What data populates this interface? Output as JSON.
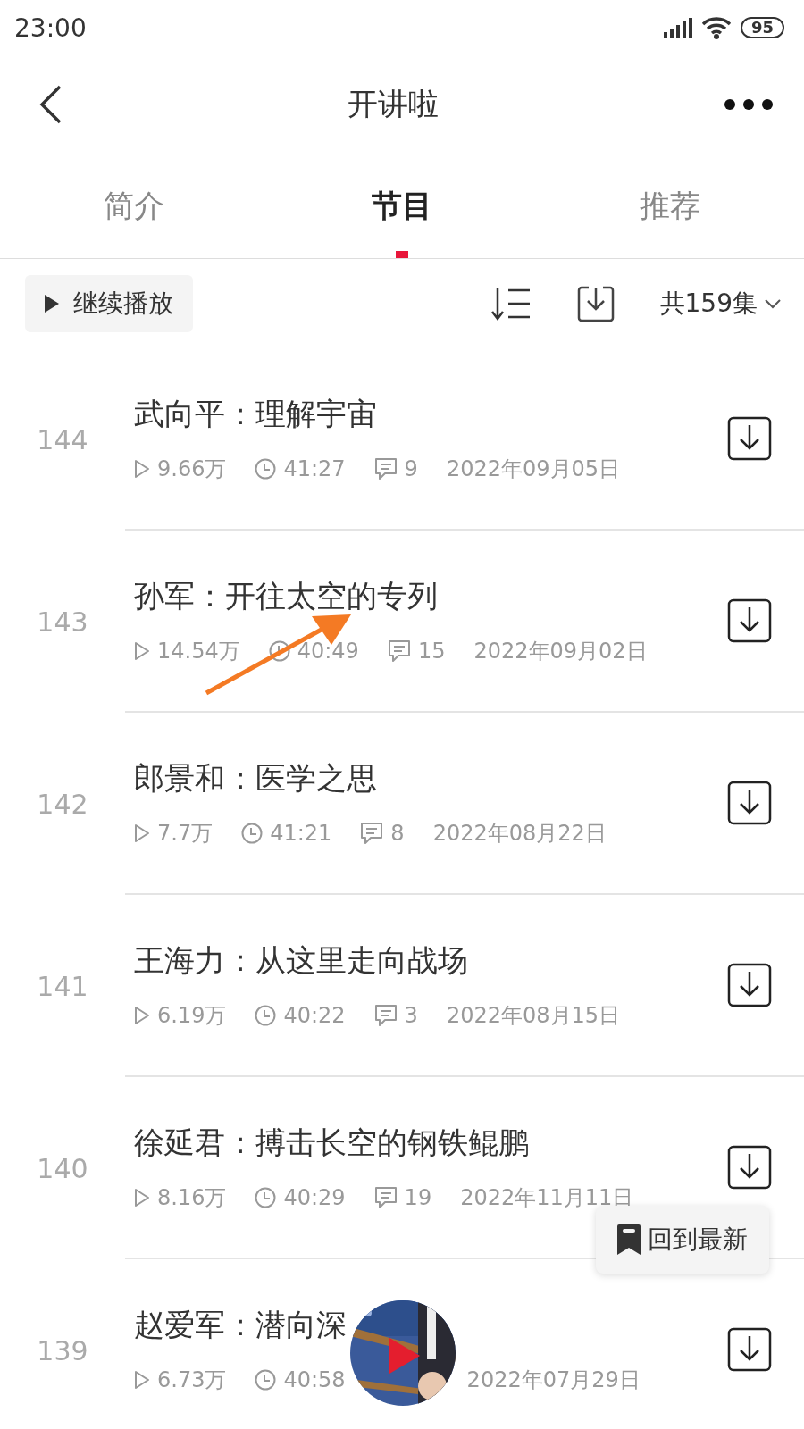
{
  "status_bar": {
    "time": "23:00",
    "battery": "95"
  },
  "nav": {
    "title": "开讲啦"
  },
  "tabs": [
    {
      "label": "简介",
      "selected": false
    },
    {
      "label": "节目",
      "selected": true
    },
    {
      "label": "推荐",
      "selected": false
    }
  ],
  "toolbar": {
    "continue_button": "继续播放",
    "count": "共159集"
  },
  "episodes": [
    {
      "number": "144",
      "title": "武向平：理解宇宙",
      "plays": "9.66万",
      "duration": "41:27",
      "comments": "9",
      "date": "2022年09月05日"
    },
    {
      "number": "143",
      "title": "孙军：开往太空的专列",
      "plays": "14.54万",
      "duration": "40:49",
      "comments": "15",
      "date": "2022年09月02日"
    },
    {
      "number": "142",
      "title": "郎景和：医学之思",
      "plays": "7.7万",
      "duration": "41:21",
      "comments": "8",
      "date": "2022年08月22日"
    },
    {
      "number": "141",
      "title": "王海力：从这里走向战场",
      "plays": "6.19万",
      "duration": "40:22",
      "comments": "3",
      "date": "2022年08月15日"
    },
    {
      "number": "140",
      "title": "徐延君：搏击长空的钢铁鲲鹏",
      "plays": "8.16万",
      "duration": "40:29",
      "comments": "19",
      "date": "2022年11月11日"
    },
    {
      "number": "139",
      "title": "赵爱军：潜向深",
      "plays": "6.73万",
      "duration": "40:58",
      "date": "2022年07月29日"
    }
  ],
  "back_to_latest": "回到最新"
}
